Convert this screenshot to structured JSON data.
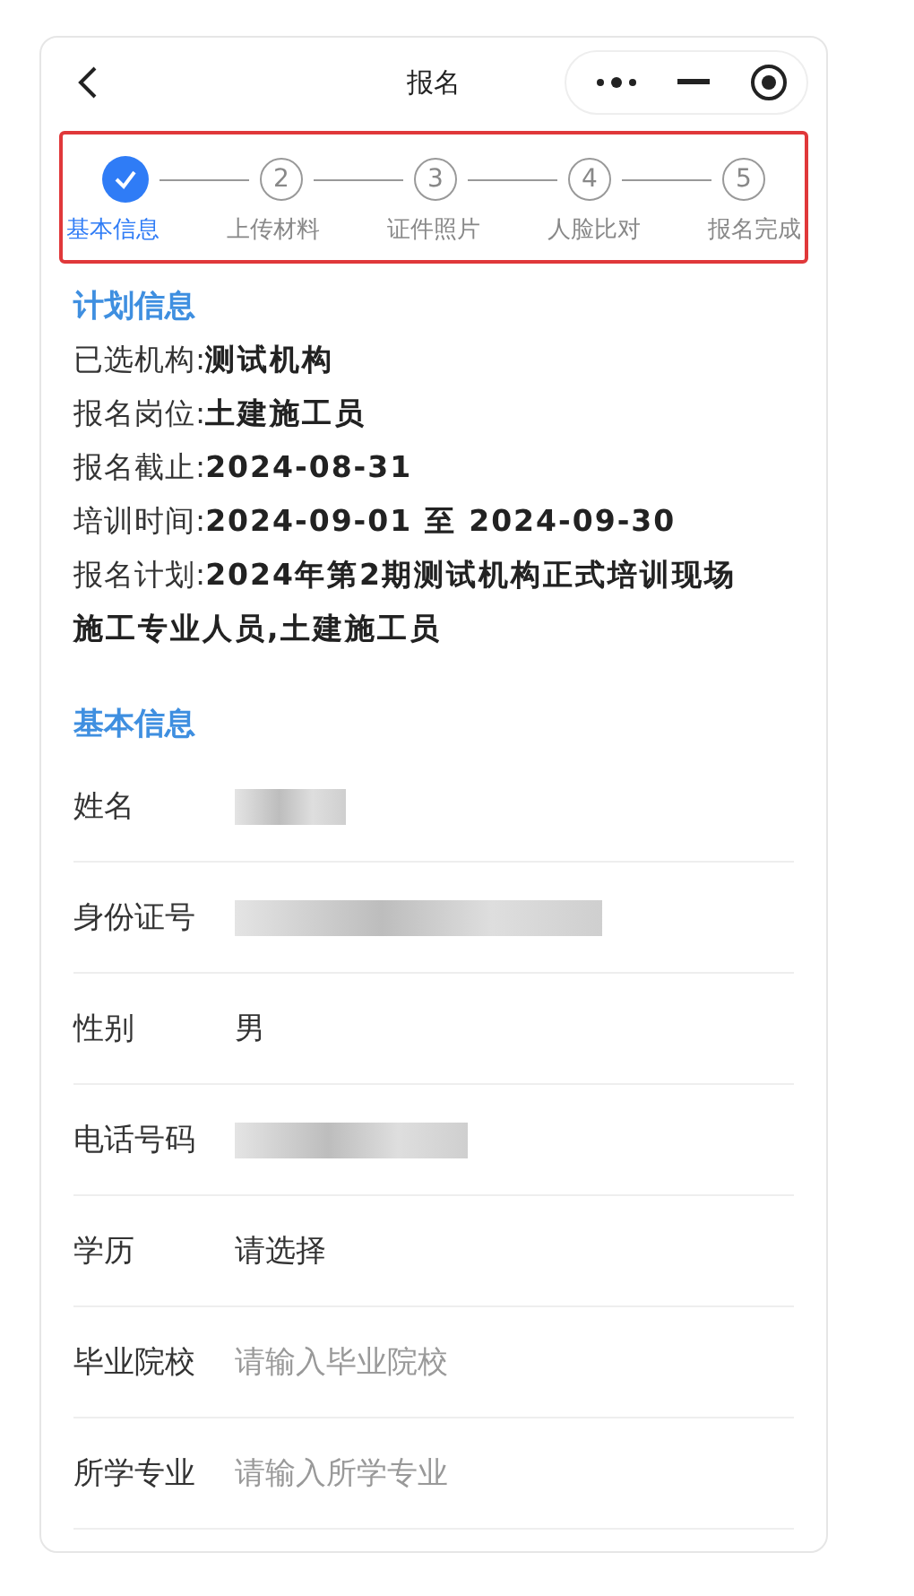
{
  "nav_bar": {
    "title": "报名"
  },
  "steps": {
    "highlighted": true,
    "items": [
      {
        "label": "基本信息",
        "done": true
      },
      {
        "number": "2",
        "label": "上传材料",
        "done": false
      },
      {
        "number": "3",
        "label": "证件照片",
        "done": false
      },
      {
        "number": "4",
        "label": "人脸比对",
        "done": false
      },
      {
        "number": "5",
        "label": "报名完成",
        "done": false
      }
    ]
  },
  "plan_info": {
    "heading": "计划信息",
    "lines": [
      "已选机构:**测试机构**",
      "报名岗位:**土建施工员**",
      "报名截止:**2024-08-31**",
      "培训时间:**2024-09-01 至 2024-09-30**",
      "报名计划:**2024年第2期测试机构正式培训现场施工专业人员,土建施工员**"
    ]
  },
  "basic_info": {
    "heading": "基本信息",
    "fields": [
      {
        "label": "姓名",
        "kind": "redacted"
      },
      {
        "label": "身份证号",
        "kind": "redacted"
      },
      {
        "label": "性别",
        "kind": "text",
        "value": "男"
      },
      {
        "label": "电话号码",
        "kind": "redacted"
      },
      {
        "label": "学历",
        "kind": "select",
        "value": "请选择"
      },
      {
        "label": "毕业院校",
        "kind": "input",
        "placeholder": "请输入毕业院校"
      },
      {
        "label": "所学专业",
        "kind": "input",
        "placeholder": "请输入所学专业"
      }
    ]
  }
}
